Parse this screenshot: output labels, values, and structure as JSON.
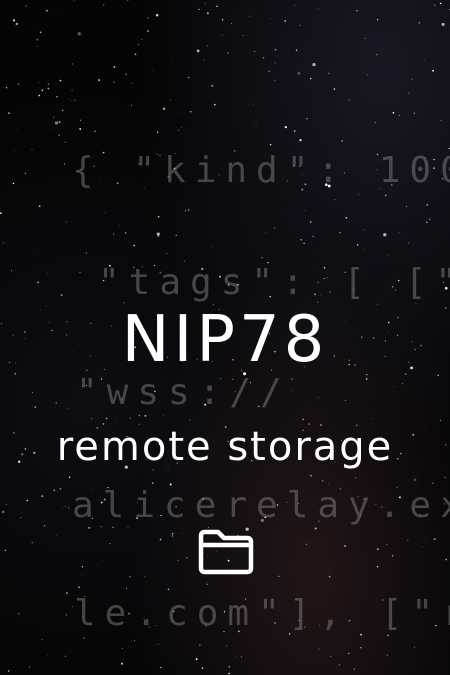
{
  "background_code": {
    "line1": "{ \"kind\": 100",
    "line2": "\"tags\": [ [\"r\"",
    "line3": "\"wss://",
    "line4": "alicerelay.ex",
    "line5": "le.com\"], [\"r\""
  },
  "title": "NIP78",
  "subtitle": "remote storage",
  "icon": "folder-icon",
  "colors": {
    "text": "#ffffff",
    "code_text": "#787878",
    "background": "#050507"
  }
}
